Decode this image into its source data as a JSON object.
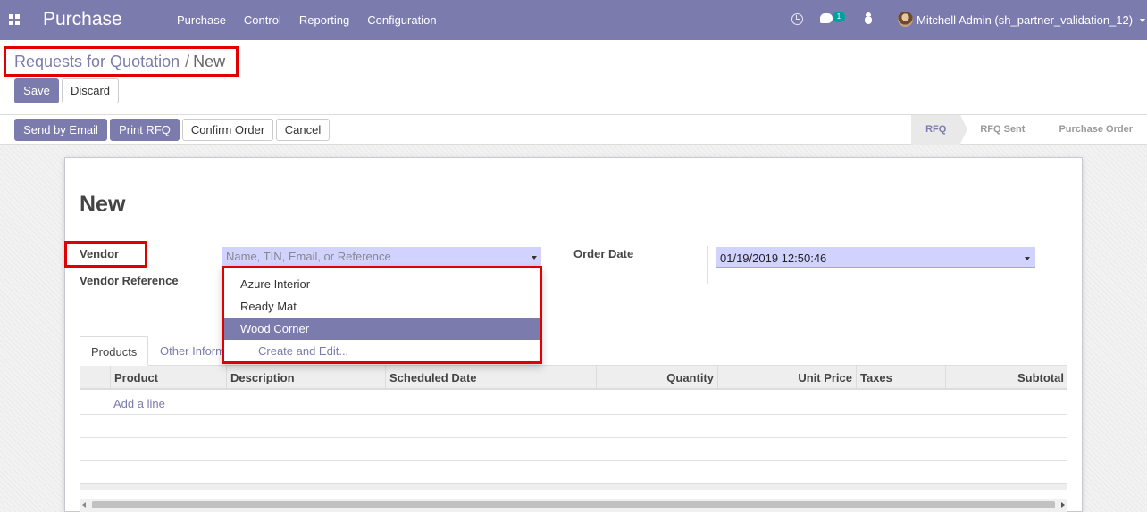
{
  "navbar": {
    "brand": "Purchase",
    "menu": [
      "Purchase",
      "Control",
      "Reporting",
      "Configuration"
    ],
    "chat_badge": "1",
    "user": "Mitchell Admin (sh_partner_validation_12)",
    "icons": [
      "apps-icon",
      "clock-icon",
      "chat-icon",
      "bug-icon",
      "avatar",
      "caret-down-icon"
    ]
  },
  "breadcrumb": {
    "parent": "Requests for Quotation",
    "separator": "/",
    "current": "New"
  },
  "control_buttons": {
    "save": "Save",
    "discard": "Discard"
  },
  "header_buttons": {
    "send_email": "Send by Email",
    "print_rfq": "Print RFQ",
    "confirm": "Confirm Order",
    "cancel": "Cancel"
  },
  "stages": [
    "RFQ",
    "RFQ Sent",
    "Purchase Order"
  ],
  "active_stage": "RFQ",
  "form": {
    "title": "New",
    "vendor_label": "Vendor",
    "vendor_placeholder": "Name, TIN, Email, or Reference",
    "vendor_ref_label": "Vendor Reference",
    "order_date_label": "Order Date",
    "order_date_value": "01/19/2019 12:50:46"
  },
  "vendor_dropdown": {
    "items": [
      "Azure Interior",
      "Ready Mat",
      "Wood Corner"
    ],
    "highlighted": "Wood Corner",
    "create_edit": "Create and Edit..."
  },
  "tabs": {
    "products": "Products",
    "other": "Other Information"
  },
  "table": {
    "columns": [
      "Product",
      "Description",
      "Scheduled Date",
      "Quantity",
      "Unit Price",
      "Taxes",
      "Subtotal"
    ],
    "add_line": "Add a line"
  },
  "colors": {
    "primary": "#7c7bad",
    "highlight_border": "#e00000",
    "input_bg": "#d2d2ff"
  }
}
